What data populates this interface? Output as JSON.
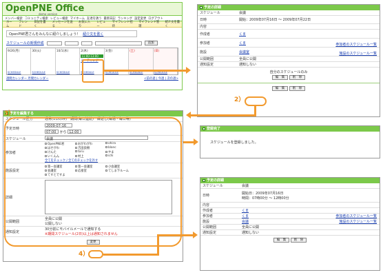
{
  "header": {
    "logo": "OpenPNE Office",
    "version": "demo version",
    "accent": "#7cc94a"
  },
  "top_nav": [
    "メンバー検索",
    "コミュニティ検索",
    "レビュー検索",
    "マイホーム",
    "友達を誘う",
    "最新日記",
    "ランキング",
    "設定変更",
    "ログアウト"
  ],
  "sub_nav": [
    "ホーム",
    "フレンド",
    "日記を書く",
    "メッセージを送る",
    "お気に入り",
    "レビュー",
    "マイフレンド招待",
    "マイフレンド管理",
    "紹介文を書く"
  ],
  "welcome": "OpenPNE君さんをみんなに紹介しましょう！",
  "welcome_link": "紹介文を書く",
  "calendar": {
    "title": "スケジュールの新規作成",
    "go": "追加",
    "days": [
      {
        "d": "9/26(月)",
        "t": "",
        "e": ""
      },
      {
        "d": "30(火)",
        "t": "",
        "e": ""
      },
      {
        "d": "10/1(水)",
        "t": "",
        "e": ""
      },
      {
        "d": "2(木)",
        "t": "11:00-13:00",
        "e": "ミーティング"
      },
      {
        "d": "3(金)",
        "t": "",
        "e": ""
      },
      {
        "d": "(土)",
        "t": "",
        "e": ""
      },
      {
        "d": "(日)",
        "t": "",
        "e": ""
      }
    ],
    "sched": "SCHEDULE",
    "left_links": "週間カレンダー   月間カレンダー",
    "right_links": "<前の週 | 今週 | 次の週>"
  },
  "detail1": {
    "head": "予定の詳細",
    "rows": [
      [
        "スケジュール",
        "会議"
      ],
      [
        "日時",
        "開始：2009年07月16日 ～ 2009年07月22日"
      ],
      [
        "内容",
        ""
      ],
      [
        "作成者",
        "くま"
      ],
      [
        "参加者",
        "くま"
      ],
      [
        "施設",
        "会議室"
      ]
    ],
    "link1": "参加者のスケジュール一覧",
    "link2": "施設のスケジュール一覧",
    "pub": [
      "公開範囲",
      "全員に公開"
    ],
    "notice": [
      "通知設定",
      "通知しない"
    ],
    "only": "自分のスケジュールのみ",
    "btn_edit": "編　集",
    "btn_del": "削　除"
  },
  "label2": "2）",
  "edit": {
    "head": "予定を編集する",
    "label3": "3）",
    "rows": {
      "kind": "スケジュール区分",
      "kind_opts": "通常(1日のみ)　期間(毎日連続)　繰返し(毎週・毎日等)",
      "date": "予定日時",
      "date_val": "2009-07-16",
      "t1": "07:00",
      "t2": "12:00",
      "from": "から",
      "sched": "スケジュール",
      "sched_val": "会議",
      "member": "参加者",
      "facility": "施設設定",
      "detail": "詳細",
      "pub": "公開範囲",
      "pub1": "全員に公開",
      "pub2": "公開しない",
      "notice": "通知設定",
      "notice_txt": "30分前にモバイルメールで通知する",
      "notice_warn": "※期間スケジュール(2日)以上は通知されません"
    },
    "members": [
      "OpenPNE君",
      "おがわがわ",
      "ohira",
      "はせがわ",
      "吉田良樹",
      "blanc",
      "けんた",
      "toru",
      "やま",
      "いくんん",
      "村上",
      "ichi"
    ],
    "member_link": "全てをチェック / 全てのチェックを外す",
    "facilities": [
      "第一会議室",
      "第一会議室",
      "小会議室",
      "会議室",
      "応接室",
      "てしま下ルーム",
      "てすとですよ"
    ],
    "label4": "4）",
    "btn_save": "変更"
  },
  "done": {
    "head": "登録完了",
    "msg": "スケジュールを登録しました。"
  },
  "detail2": {
    "head": "予定の詳細",
    "rows": [
      [
        "スケジュール",
        "会議"
      ],
      [
        "日時",
        "開始日：2009年07月16日\n時間：07時00分 ～ 12時00分"
      ],
      [
        "内容",
        ""
      ],
      [
        "作成者",
        "くま"
      ],
      [
        "参加者",
        "くま"
      ],
      [
        "施設",
        "会議"
      ],
      [
        "公開範囲",
        "全員に公開"
      ],
      [
        "通知設定",
        "通知しない"
      ]
    ],
    "link1": "参加者のスケジュール一覧",
    "link2": "施設のスケジュール一覧",
    "btn_edit": "編　集",
    "btn_del": "削　除"
  }
}
